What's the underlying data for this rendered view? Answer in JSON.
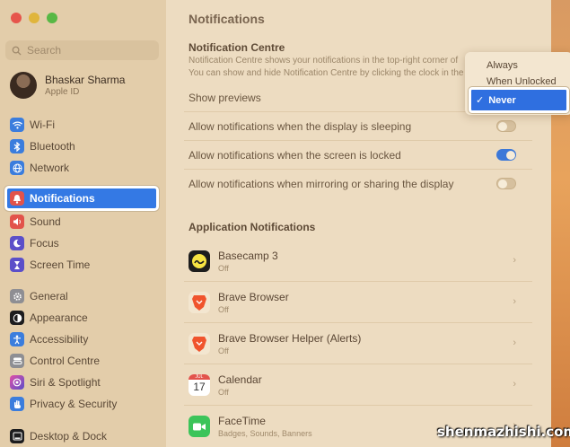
{
  "sidebar": {
    "search_placeholder": "Search",
    "profile": {
      "name": "Bhaskar Sharma",
      "subtitle": "Apple ID"
    },
    "items": [
      {
        "label": "Wi-Fi",
        "icon": "wifi-icon",
        "color": "#3b7ddd"
      },
      {
        "label": "Bluetooth",
        "icon": "bluetooth-icon",
        "color": "#3b7ddd"
      },
      {
        "label": "Network",
        "icon": "globe-icon",
        "color": "#3b7ddd"
      },
      {
        "label": "Notifications",
        "icon": "bell-icon",
        "color": "#e2534b"
      },
      {
        "label": "Sound",
        "icon": "speaker-icon",
        "color": "#e2534b"
      },
      {
        "label": "Focus",
        "icon": "moon-icon",
        "color": "#5b4fc9"
      },
      {
        "label": "Screen Time",
        "icon": "hourglass-icon",
        "color": "#5b4fc9"
      },
      {
        "label": "General",
        "icon": "gear-icon",
        "color": "#8e8e93"
      },
      {
        "label": "Appearance",
        "icon": "appearance-icon",
        "color": "#1c1c1e"
      },
      {
        "label": "Accessibility",
        "icon": "accessibility-icon",
        "color": "#3b7ddd"
      },
      {
        "label": "Control Centre",
        "icon": "control-centre-icon",
        "color": "#8e8e93"
      },
      {
        "label": "Siri & Spotlight",
        "icon": "siri-icon",
        "color": "#a64fc9"
      },
      {
        "label": "Privacy & Security",
        "icon": "hand-icon",
        "color": "#3b7ddd"
      },
      {
        "label": "Desktop & Dock",
        "icon": "dock-icon",
        "color": "#1c1c1e"
      }
    ],
    "active_color": "#3479e4"
  },
  "main": {
    "title": "Notifications",
    "notification_centre": {
      "title": "Notification Centre",
      "desc_line1": "Notification Centre shows your notifications in the top-right corner of",
      "desc_line2": "You can show and hide Notification Centre by clicking the clock in the"
    },
    "rows": [
      {
        "label": "Show previews"
      },
      {
        "label": "Allow notifications when the display is sleeping",
        "toggle": false
      },
      {
        "label": "Allow notifications when the screen is locked",
        "toggle": true
      },
      {
        "label": "Allow notifications when mirroring or sharing the display",
        "toggle": false
      }
    ],
    "app_section_title": "Application Notifications",
    "apps": [
      {
        "name": "Basecamp 3",
        "status": "Off",
        "icon": "basecamp-icon"
      },
      {
        "name": "Brave Browser",
        "status": "Off",
        "icon": "brave-icon"
      },
      {
        "name": "Brave Browser Helper (Alerts)",
        "status": "Off",
        "icon": "brave-icon"
      },
      {
        "name": "Calendar",
        "status": "Off",
        "icon": "calendar-icon",
        "calendar_month": "JUL",
        "calendar_day": "17"
      },
      {
        "name": "FaceTime",
        "status": "Badges, Sounds, Banners",
        "icon": "facetime-icon"
      }
    ]
  },
  "preview_menu": {
    "options": [
      "Always",
      "When Unlocked",
      "Never"
    ],
    "selected": "Never",
    "check": "✓"
  },
  "watermark": "shenmazhishi.com"
}
